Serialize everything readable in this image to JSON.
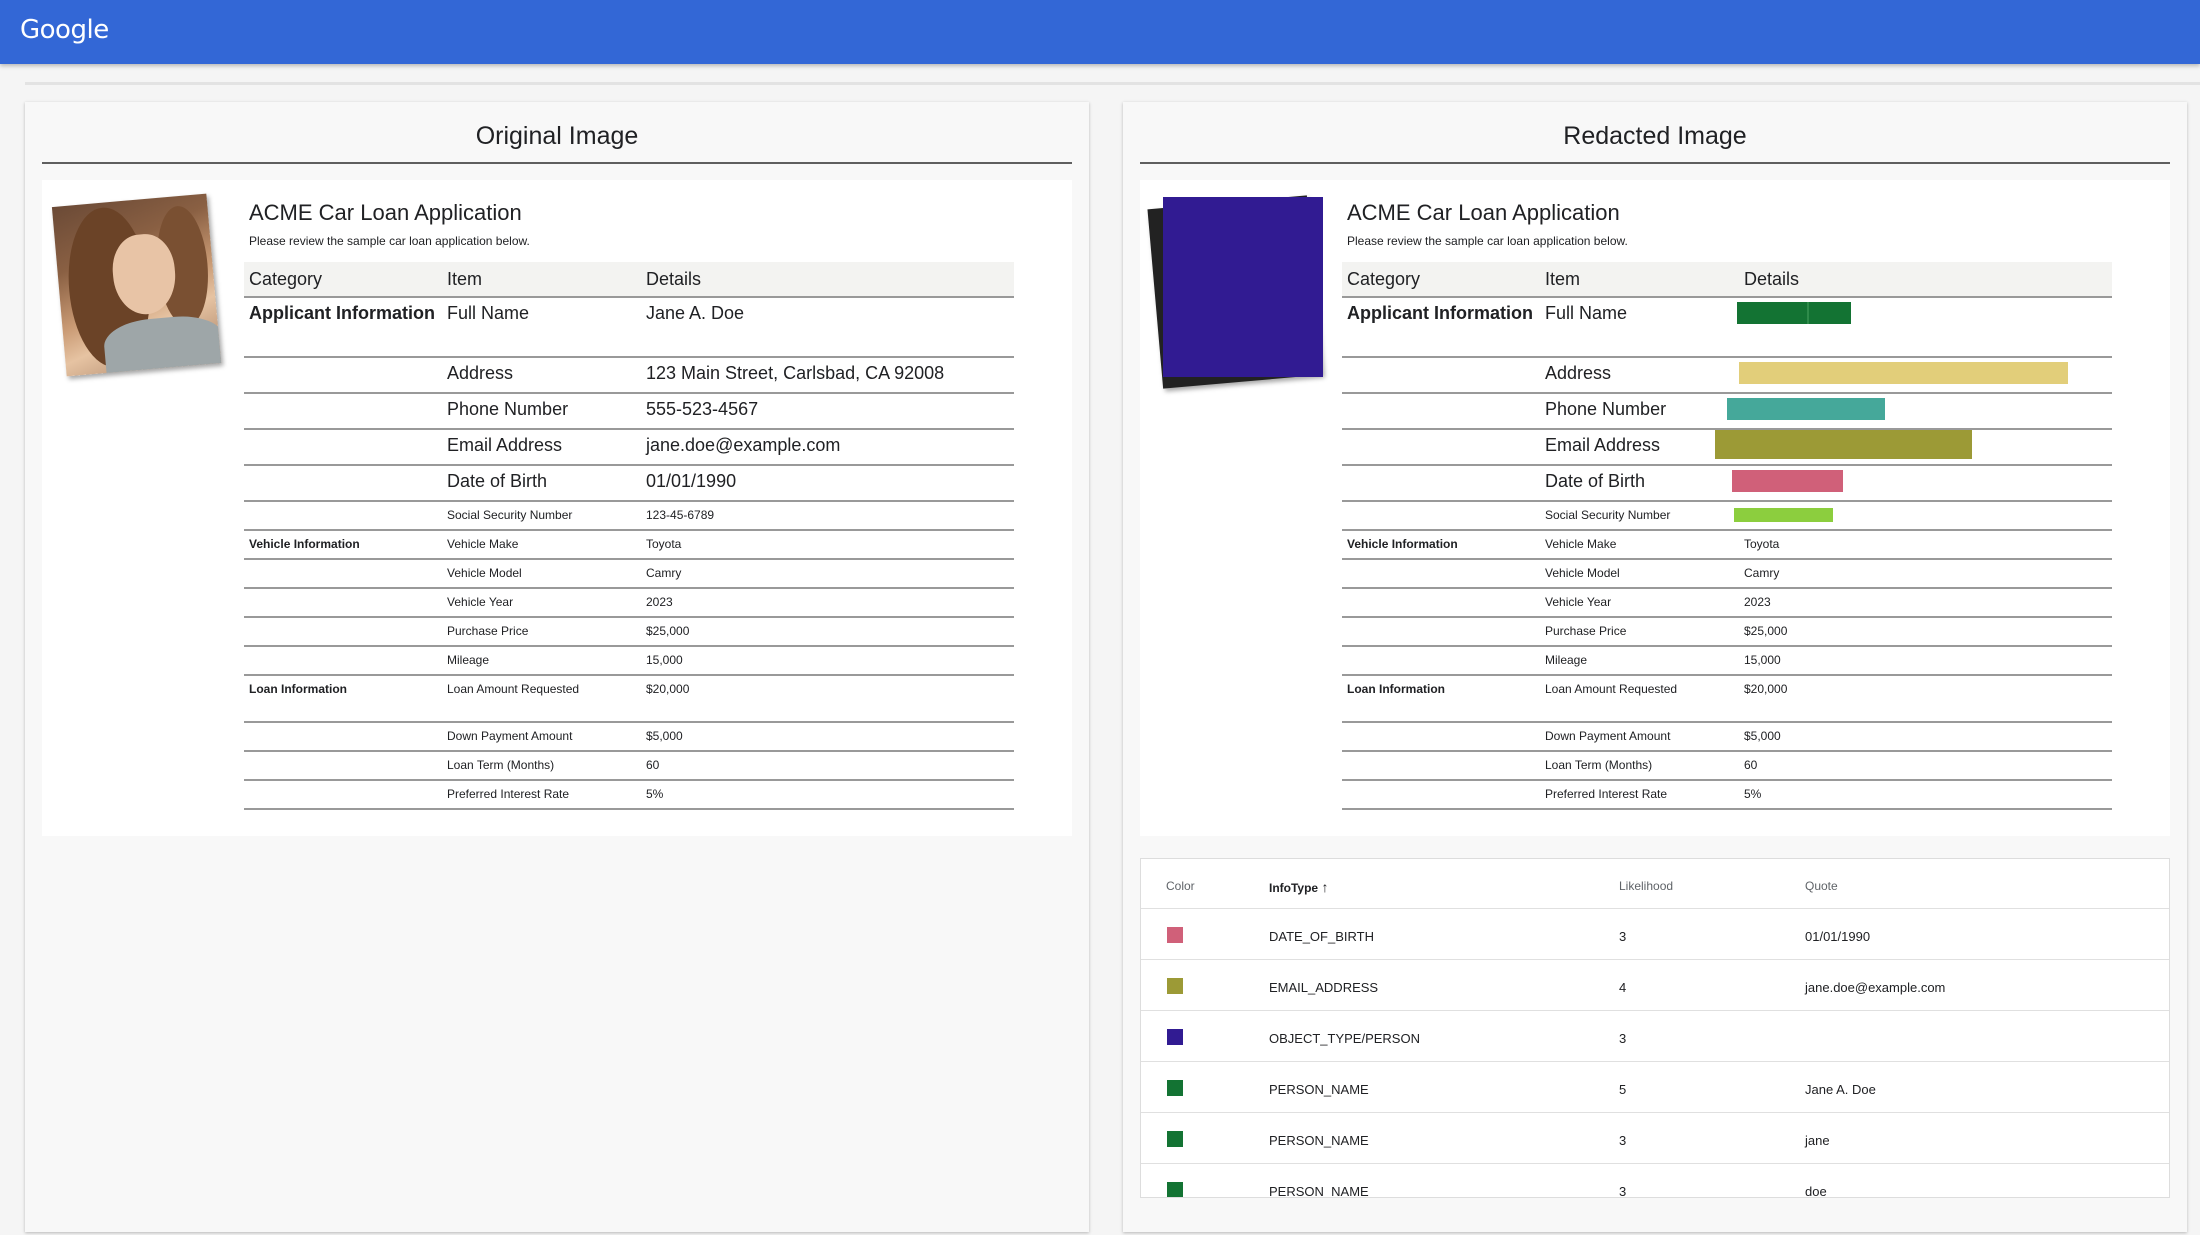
{
  "header": {
    "logo": "Google"
  },
  "panels": {
    "original_title": "Original Image",
    "redacted_title": "Redacted Image"
  },
  "document": {
    "title": "ACME Car Loan Application",
    "subtitle": "Please review the sample car loan application below.",
    "columns": [
      "Category",
      "Item",
      "Details"
    ],
    "rows": [
      [
        "Applicant Information",
        "Full Name",
        "Jane A. Doe"
      ],
      [
        "",
        "Address",
        "123 Main Street, Carlsbad, CA 92008"
      ],
      [
        "",
        "Phone Number",
        "555-523-4567"
      ],
      [
        "",
        "Email Address",
        "jane.doe@example.com"
      ],
      [
        "",
        "Date of Birth",
        "01/01/1990"
      ],
      [
        "",
        "Social Security Number",
        "123-45-6789"
      ],
      [
        "Vehicle Information",
        "Vehicle Make",
        "Toyota"
      ],
      [
        "",
        "Vehicle Model",
        "Camry"
      ],
      [
        "",
        "Vehicle Year",
        "2023"
      ],
      [
        "",
        "Purchase Price",
        "$25,000"
      ],
      [
        "",
        "Mileage",
        "15,000"
      ],
      [
        "Loan Information",
        "Loan Amount Requested",
        "$20,000"
      ],
      [
        "",
        "Down Payment Amount",
        "$5,000"
      ],
      [
        "",
        "Loan Term (Months)",
        "60"
      ],
      [
        "",
        "Preferred Interest Rate",
        "5%"
      ]
    ]
  },
  "redaction_colors": {
    "photo": "#311b92",
    "full_name": "#137333",
    "address": "#e2ce7a",
    "phone": "#45a89a",
    "email": "#9c9a36",
    "dob": "#d06079",
    "ssn": "#8cce3e"
  },
  "findings": {
    "columns": {
      "color": "Color",
      "infotype": "InfoType",
      "likelihood": "Likelihood",
      "quote": "Quote"
    },
    "sort_icon": "arrow-up-icon",
    "rows": [
      {
        "color": "#d06079",
        "infotype": "DATE_OF_BIRTH",
        "likelihood": "3",
        "quote": "01/01/1990"
      },
      {
        "color": "#9c9a36",
        "infotype": "EMAIL_ADDRESS",
        "likelihood": "4",
        "quote": "jane.doe@example.com"
      },
      {
        "color": "#311b92",
        "infotype": "OBJECT_TYPE/PERSON",
        "likelihood": "3",
        "quote": ""
      },
      {
        "color": "#137333",
        "infotype": "PERSON_NAME",
        "likelihood": "5",
        "quote": "Jane A. Doe"
      },
      {
        "color": "#137333",
        "infotype": "PERSON_NAME",
        "likelihood": "3",
        "quote": "jane"
      },
      {
        "color": "#137333",
        "infotype": "PERSON_NAME",
        "likelihood": "3",
        "quote": "doe"
      }
    ]
  }
}
